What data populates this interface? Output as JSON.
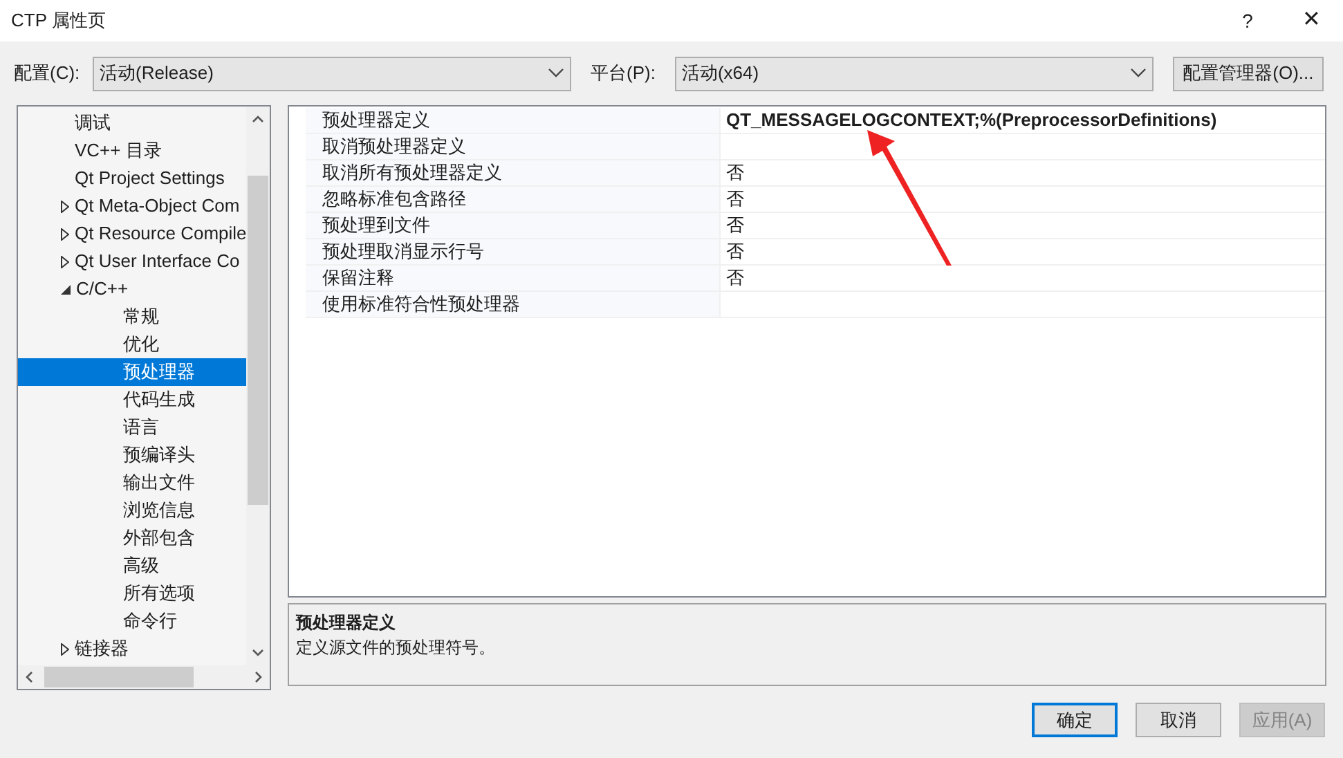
{
  "window": {
    "title": "CTP 属性页",
    "help": "?",
    "close": "✕"
  },
  "toolbar": {
    "config_label": "配置(C):",
    "config_value": "活动(Release)",
    "platform_label": "平台(P):",
    "platform_value": "活动(x64)",
    "manager_button": "配置管理器(O)..."
  },
  "tree": [
    {
      "label": "调试"
    },
    {
      "label": "VC++ 目录"
    },
    {
      "label": "Qt Project Settings"
    },
    {
      "label": "Qt Meta-Object Com",
      "expanded": false
    },
    {
      "label": "Qt Resource Compile",
      "expanded": false
    },
    {
      "label": "Qt User Interface Co",
      "expanded": false
    },
    {
      "label": "C/C++",
      "expanded": true,
      "children": [
        {
          "label": "常规",
          "selected": false
        },
        {
          "label": "优化",
          "selected": false
        },
        {
          "label": "预处理器",
          "selected": true
        },
        {
          "label": "代码生成",
          "selected": false
        },
        {
          "label": "语言",
          "selected": false
        },
        {
          "label": "预编译头",
          "selected": false
        },
        {
          "label": "输出文件",
          "selected": false
        },
        {
          "label": "浏览信息",
          "selected": false
        },
        {
          "label": "外部包含",
          "selected": false
        },
        {
          "label": "高级",
          "selected": false
        },
        {
          "label": "所有选项",
          "selected": false
        },
        {
          "label": "命令行",
          "selected": false
        }
      ]
    },
    {
      "label": "链接器",
      "expanded": false
    }
  ],
  "properties": [
    {
      "name": "预处理器定义",
      "value": "QT_MESSAGELOGCONTEXT;%(PreprocessorDefinitions)",
      "bold": true
    },
    {
      "name": "取消预处理器定义"
    },
    {
      "name": "取消所有预处理器定义",
      "value": "否",
      "bold": false
    },
    {
      "name": "忽略标准包含路径",
      "value": "否",
      "bold": false
    },
    {
      "name": "预处理到文件",
      "value": "否",
      "bold": false
    },
    {
      "name": "预处理取消显示行号",
      "value": "否",
      "bold": false
    },
    {
      "name": "保留注释",
      "value": "否",
      "bold": false
    },
    {
      "name": "使用标准符合性预处理器"
    }
  ],
  "description": {
    "title": "预处理器定义",
    "text": "定义源文件的预处理符号。"
  },
  "buttons": [
    {
      "label": "确定",
      "default": true,
      "disabled": false
    },
    {
      "label": "取消",
      "default": false,
      "disabled": false
    },
    {
      "label": "应用(A)",
      "default": false,
      "disabled": true
    }
  ]
}
